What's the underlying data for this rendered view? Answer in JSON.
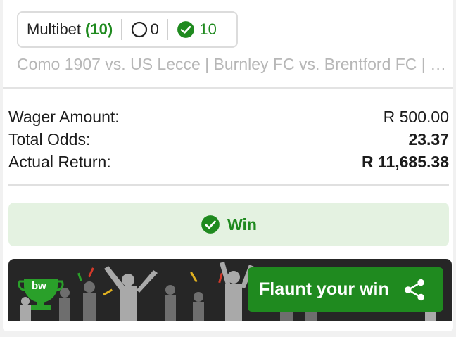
{
  "bet": {
    "type_label": "Multibet",
    "legs_count": "(10)",
    "open_count": "0",
    "won_count": "10",
    "events_summary": "Como 1907 vs. US Lecce | Burnley FC vs. Brentford FC | …"
  },
  "summary": {
    "wager_label": "Wager Amount:",
    "wager_value": "R 500.00",
    "odds_label": "Total Odds:",
    "odds_value": "23.37",
    "return_label": "Actual Return:",
    "return_value": "R 11,685.38"
  },
  "status": {
    "label": "Win",
    "icon": "check-circle-icon"
  },
  "promo": {
    "logo_text": "bw",
    "button_label": "Flaunt your win",
    "button_icon": "share-icon"
  },
  "colors": {
    "accent_green": "#1f8a1f",
    "win_bg": "#e4f2e1",
    "banner_bg": "#262626"
  }
}
